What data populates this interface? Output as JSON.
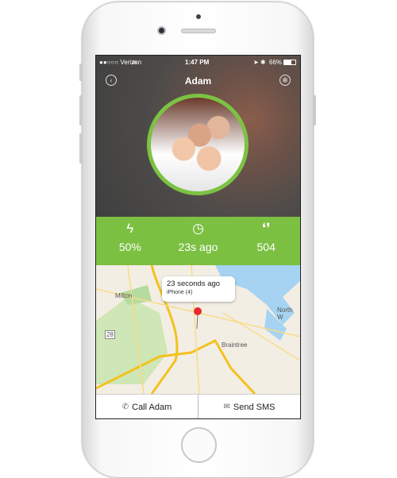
{
  "status_bar": {
    "carrier": "●●○○○ Verizon",
    "time": "1:47 PM",
    "battery": "66%"
  },
  "header": {
    "title": "Adam",
    "back_icon": "back-icon",
    "settings_icon": "gear-icon"
  },
  "stats": [
    {
      "icon": "lightning-icon",
      "value": "50%"
    },
    {
      "icon": "clock-icon",
      "value": "23s ago"
    },
    {
      "icon": "footsteps-icon",
      "value": "504"
    }
  ],
  "map": {
    "callout_title": "23 seconds ago",
    "callout_subtitle": "iPhone (4)",
    "labels": {
      "milton": "Milton",
      "braintree": "Braintree",
      "north": "North W",
      "route": "28"
    }
  },
  "actions": {
    "call": "Call Adam",
    "sms": "Send SMS"
  },
  "colors": {
    "accent": "#7cc042"
  }
}
